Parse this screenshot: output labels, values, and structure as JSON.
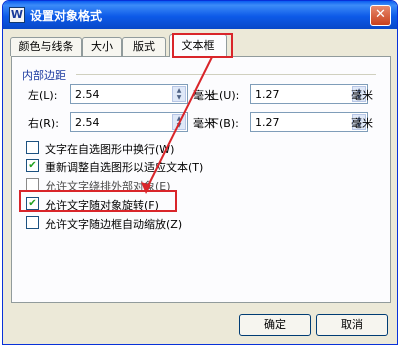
{
  "window": {
    "title": "设置对象格式",
    "app_icon_letter": "W",
    "close_glyph": "✕"
  },
  "tabs": [
    {
      "label": "颜色与线条",
      "active": false
    },
    {
      "label": "大小",
      "active": false
    },
    {
      "label": "版式",
      "active": false
    },
    {
      "label": "文本框",
      "active": true
    }
  ],
  "margins": {
    "group_label": "内部边距",
    "left": {
      "label": "左(L):",
      "value": "2.54",
      "unit": "毫米"
    },
    "right": {
      "label": "右(R):",
      "value": "2.54",
      "unit": "毫米"
    },
    "top": {
      "label": "上(U):",
      "value": "1.27",
      "unit": "毫米"
    },
    "bottom": {
      "label": "下(B):",
      "value": "1.27",
      "unit": "毫米"
    }
  },
  "options": [
    {
      "label": "文字在自选图形中换行(W)",
      "checked": false,
      "enabled": true
    },
    {
      "label": "重新调整自选图形以适应文本(T)",
      "checked": true,
      "enabled": true
    },
    {
      "label": "允许文字绕排外部对象(E)",
      "checked": false,
      "enabled": false
    },
    {
      "label": "允许文字随对象旋转(F)",
      "checked": true,
      "enabled": true
    },
    {
      "label": "允许文字随边框自动缩放(Z)",
      "checked": false,
      "enabled": true
    }
  ],
  "buttons": {
    "ok": "确定",
    "cancel": "取消"
  },
  "icons": {
    "check_glyph": "✔",
    "spin_glyph_up": "▲",
    "spin_glyph_down": "▼"
  },
  "colors": {
    "annotation": "#d9252a",
    "titlebar": "#0d5ae8",
    "checkmark": "#21a121"
  }
}
